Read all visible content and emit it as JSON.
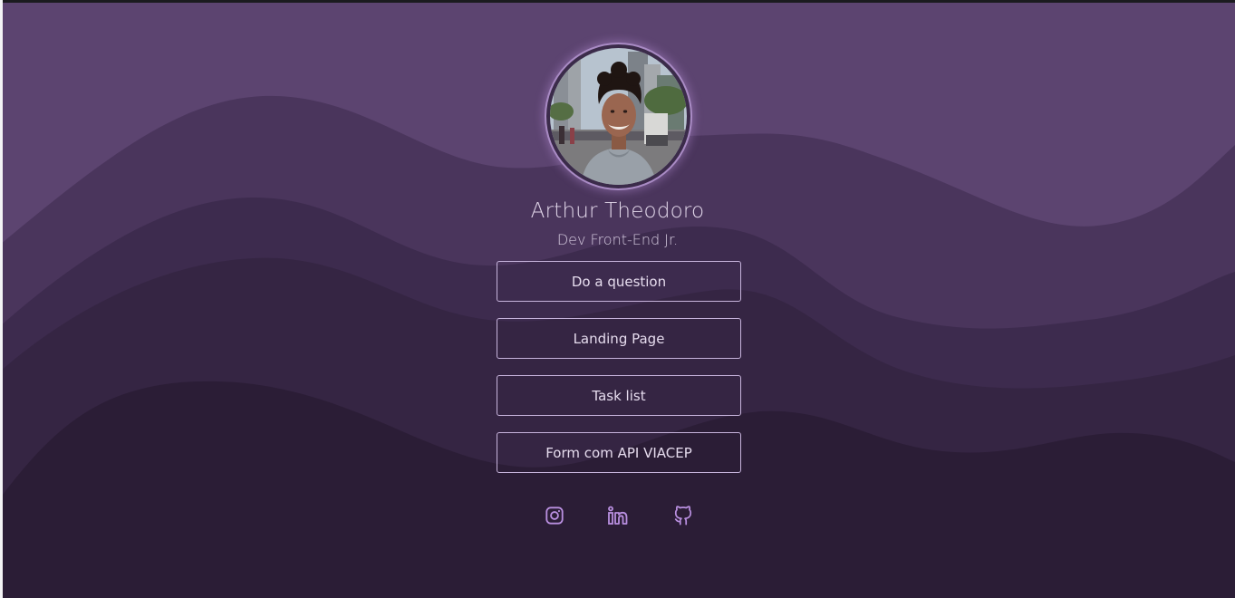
{
  "profile": {
    "name": "Arthur Theodoro",
    "role": "Dev Front-End Jr.",
    "avatar": "profile-photo"
  },
  "links": [
    {
      "label": "Do a question"
    },
    {
      "label": "Landing Page"
    },
    {
      "label": "Task list"
    },
    {
      "label": "Form com API VIACEP"
    }
  ],
  "social": [
    {
      "icon": "instagram-icon"
    },
    {
      "icon": "linkedin-icon"
    },
    {
      "icon": "github-icon"
    }
  ],
  "colors": {
    "wave_1": "#5c4470",
    "wave_2": "#4a355c",
    "wave_3": "#3d2b4e",
    "wave_4": "#352543",
    "wave_5": "#2b1d36",
    "accent": "#c7b4dc",
    "icon": "#b98fe0"
  }
}
